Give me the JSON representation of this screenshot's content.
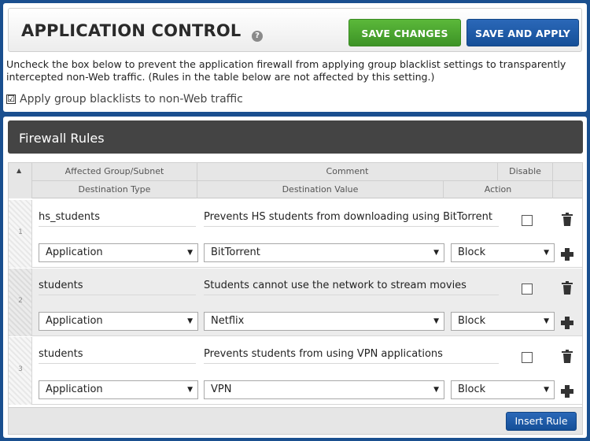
{
  "header": {
    "title": "APPLICATION CONTROL",
    "help_icon": "?",
    "save_label": "SAVE CHANGES",
    "apply_label": "SAVE AND APPLY"
  },
  "settings": {
    "description": "Uncheck the box below to prevent the application firewall from applying group blacklist settings to transparently intercepted non-Web traffic. (Rules in the table below are not affected by this setting.)",
    "checkbox_mark": "☑",
    "checkbox_label": "Apply group blacklists to non-Web traffic",
    "checkbox_checked": true
  },
  "firewall": {
    "title": "Firewall Rules",
    "columns": {
      "sort_arrow": "▲",
      "group": "Affected Group/Subnet",
      "comment": "Comment",
      "disable": "Disable",
      "dest_type": "Destination Type",
      "dest_value": "Destination Value",
      "action": "Action"
    },
    "rows": [
      {
        "num": "1",
        "group": "hs_students",
        "comment": "Prevents HS students from downloading using BitTorrent",
        "dest_type": "Application",
        "dest_value": "BitTorrent",
        "action": "Block",
        "disabled": false
      },
      {
        "num": "2",
        "group": "students",
        "comment": "Students cannot use the network to stream movies",
        "dest_type": "Application",
        "dest_value": "Netflix",
        "action": "Block",
        "disabled": false
      },
      {
        "num": "3",
        "group": "students",
        "comment": "Prevents students from using VPN applications",
        "dest_type": "Application",
        "dest_value": "VPN",
        "action": "Block",
        "disabled": false
      }
    ],
    "insert_label": "Insert Rule"
  },
  "icons": {
    "caret": "▼",
    "trash": "trash-icon",
    "plus": "plus-icon",
    "help": "help-icon"
  },
  "colors": {
    "background": "#1a4f8f",
    "save_green": "#4aa52e",
    "apply_blue": "#1d5ba8",
    "header_dark": "#444444"
  }
}
